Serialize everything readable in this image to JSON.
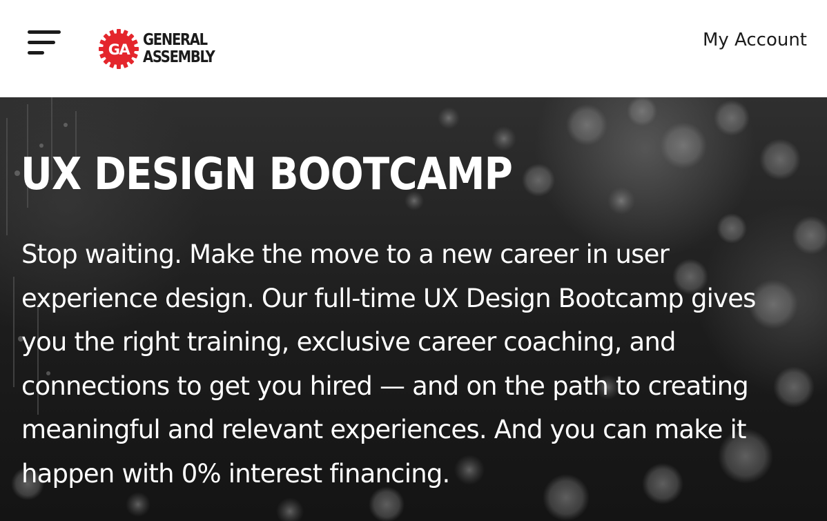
{
  "header": {
    "menu_icon": "hamburger-menu-icon",
    "logo": {
      "badge_text": "GA",
      "line1": "GENERAL",
      "line2": "ASSEMBLY",
      "badge_color": "#e4262c"
    },
    "account_label": "My Account"
  },
  "hero": {
    "title": "UX DESIGN BOOTCAMP",
    "description": "Stop waiting. Make the move to a new career in user experience design. Our full-time UX Design Bootcamp gives you the right training, exclusive career coaching, and connections to get you hired — and on the path to creating meaningful and relevant experiences. And you can make it happen with 0% interest financing.",
    "background": "dark bokeh photo"
  },
  "colors": {
    "text_dark": "#1b1b1b",
    "hero_text": "#ffffff",
    "brand_red": "#e4262c"
  }
}
